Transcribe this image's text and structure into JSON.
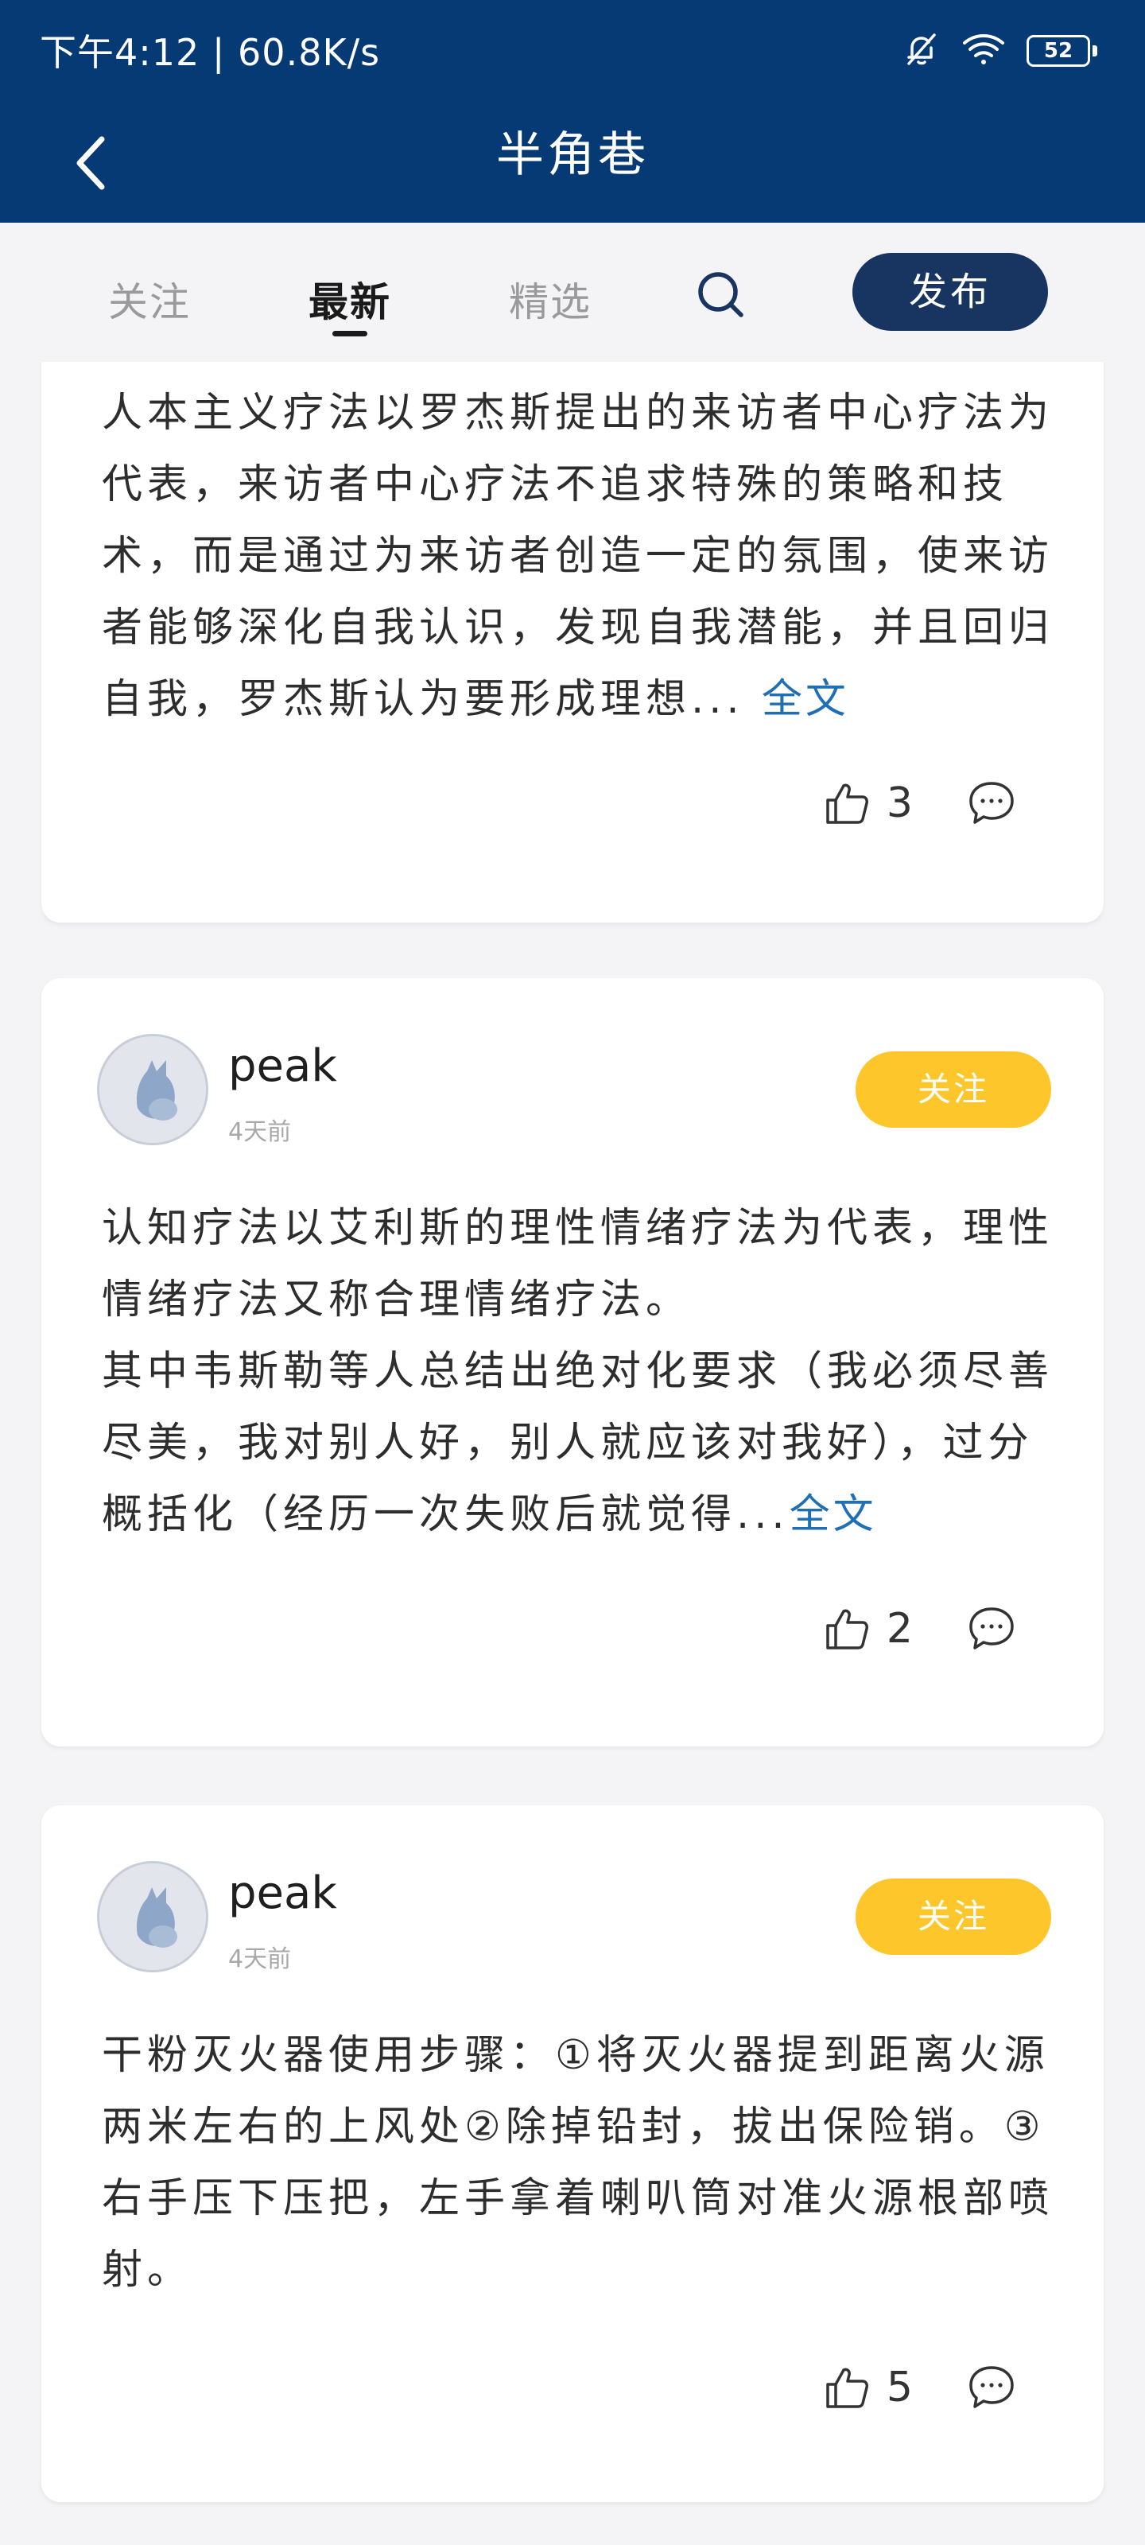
{
  "status_bar": {
    "text": "下午4:12 | 60.8K/s",
    "battery": "52",
    "icons": [
      "bell-off-icon",
      "wifi-icon",
      "battery-icon"
    ]
  },
  "header": {
    "title": "半角巷"
  },
  "tabs": [
    {
      "label": "关注"
    },
    {
      "label": "最新"
    },
    {
      "label": "精选"
    }
  ],
  "active_tab": "最新",
  "publish_label": "发布",
  "colors": {
    "header_bg": "#063a75",
    "publish_bg": "#183461",
    "follow_bg": "#fdc72c",
    "link": "#1e6fb5",
    "page_bg": "#f4f4f6"
  },
  "posts": [
    {
      "text": "人本主义疗法以罗杰斯提出的来访者中心疗法为代表，来访者中心疗法不追求特殊的策略和技术，而是通过为来访者创造一定的氛围，使来访者能够深化自我认识，发现自我潜能，并且回归自我，罗杰斯认为要形成理想...",
      "full_label": "全文",
      "likes": "3"
    },
    {
      "author": "peak",
      "time": "4天前",
      "follow_label": "关注",
      "text": "认知疗法以艾利斯的理性情绪疗法为代表，理性情绪疗法又称合理情绪疗法。\n其中韦斯勒等人总结出绝对化要求（我必须尽善尽美，我对别人好，别人就应该对我好），过分概括化（经历一次失败后就觉得...",
      "full_label": "全文",
      "likes": "2"
    },
    {
      "author": "peak",
      "time": "4天前",
      "follow_label": "关注",
      "text": "干粉灭火器使用步骤：①将灭火器提到距离火源两米左右的上风处②除掉铅封，拔出保险销。③右手压下压把，左手拿着喇叭筒对准火源根部喷射。",
      "likes": "5"
    }
  ]
}
